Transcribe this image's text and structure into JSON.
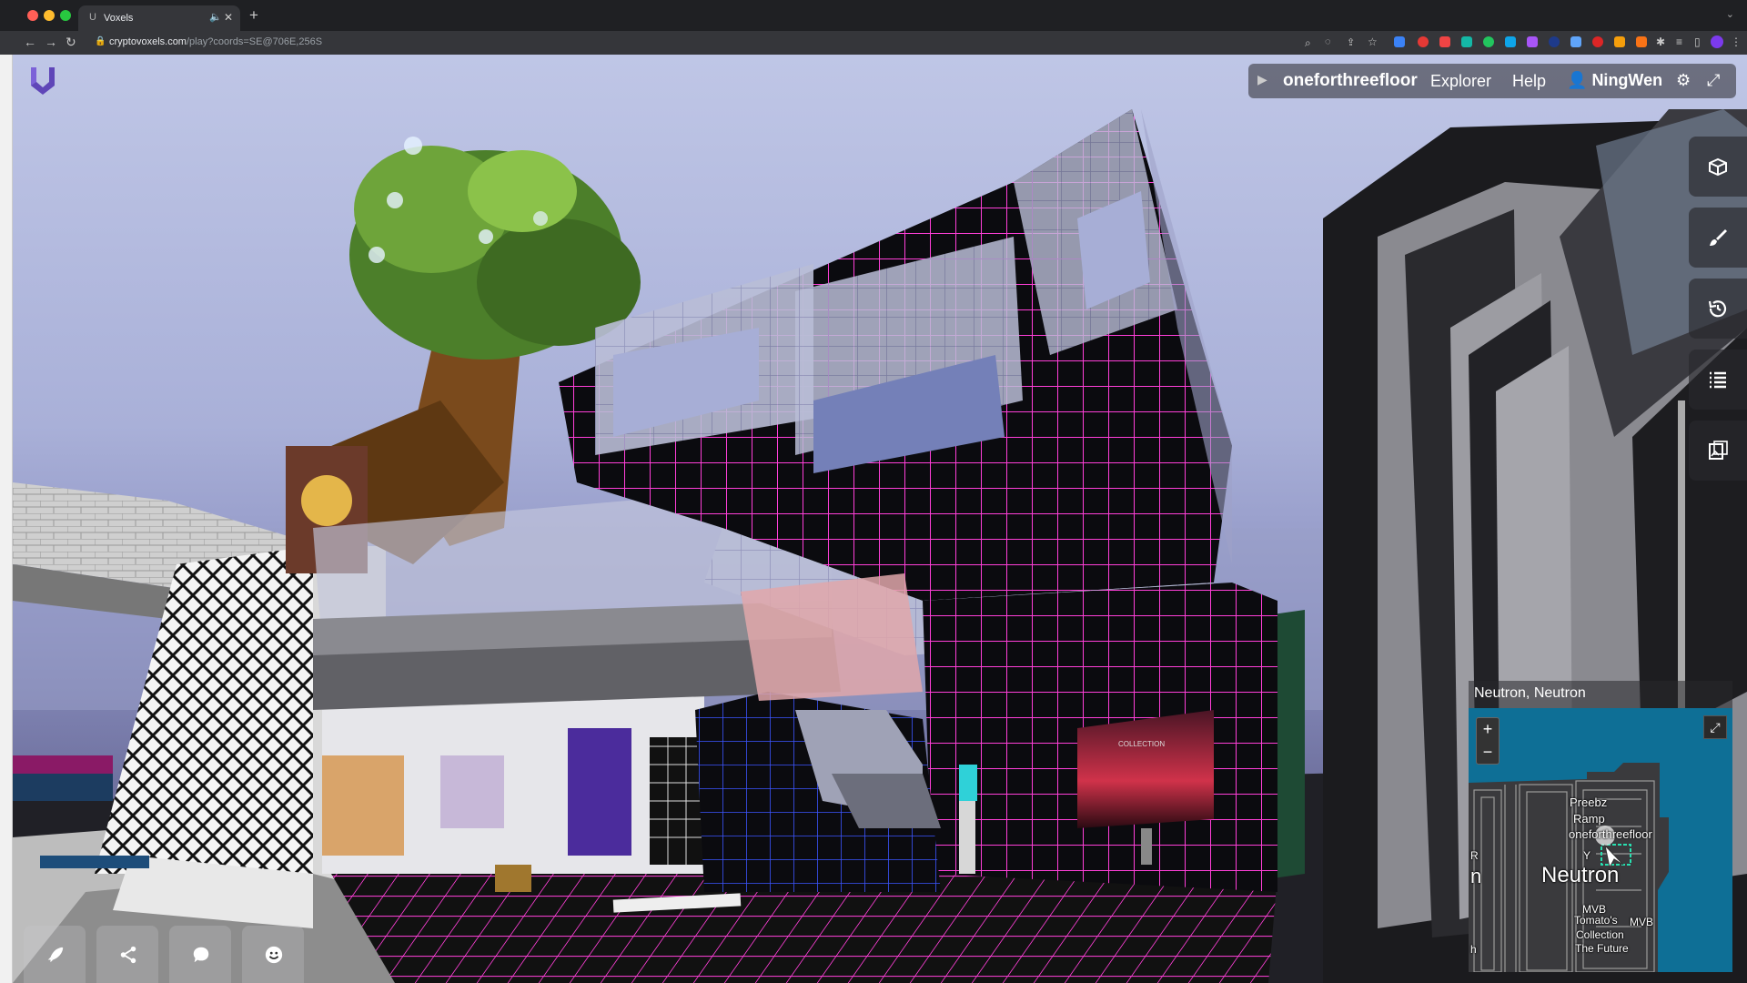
{
  "browser": {
    "tab_title": "Voxels",
    "url_host": "cryptovoxels.com",
    "url_path": "/play?coords=SE@706E,256S"
  },
  "app": {
    "parcel_name": "oneforthreefloor",
    "nav_links": [
      "Explorer",
      "Help"
    ],
    "username": "NingWen"
  },
  "right_tools": [
    "cubes-icon",
    "brush-icon",
    "history-icon",
    "list-icon",
    "gallery-icon"
  ],
  "bottom_tools": [
    "rocket-icon",
    "share-icon",
    "chat-icon",
    "smiley-icon"
  ],
  "minimap": {
    "title": "Neutron, Neutron",
    "zoom_in": "+",
    "zoom_out": "−",
    "labels": {
      "preebz": "Preebz",
      "ramp": "Ramp",
      "parcel": "oneforthreefloor",
      "suburb": "Neutron",
      "mvb1": "MVB",
      "mvb2": "MVB",
      "tomatos": "Tomato's",
      "collection": "Collection",
      "future": "The Future",
      "y": "Y",
      "r": "R",
      "n": "n",
      "h": "h"
    }
  },
  "scene": {
    "screen_text": "COLLECTION"
  },
  "colors": {
    "grid_magenta": "#ff3fd8",
    "voxel_dark": "#0b0b0f",
    "map_water": "#0e6f96"
  }
}
